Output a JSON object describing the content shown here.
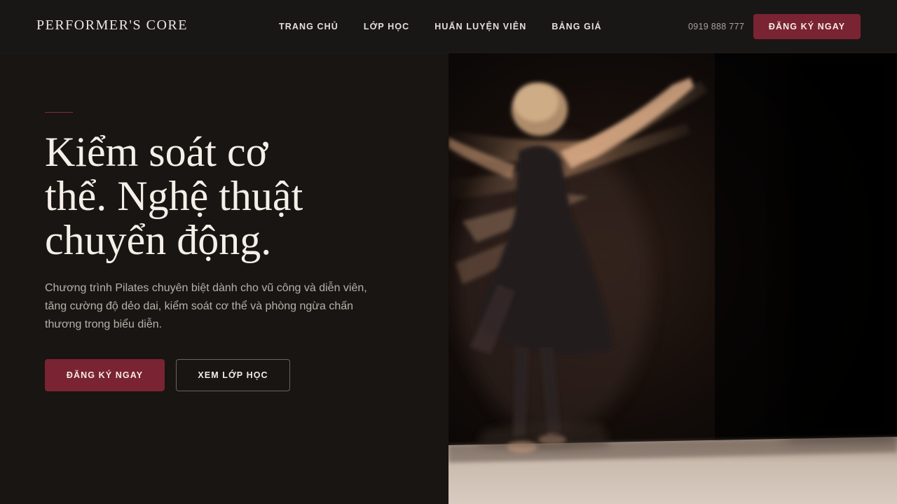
{
  "header": {
    "brand": "PERFORMER'S CORE",
    "nav": [
      "TRANG CHỦ",
      "LỚP HỌC",
      "HUẤN LUYỆN VIÊN",
      "BẢNG GIÁ"
    ],
    "phone": "0919 888 777",
    "cta_label": "ĐĂNG KÝ NGAY"
  },
  "hero": {
    "title_lines": [
      "Kiểm soát cơ",
      "thể. Nghệ thuật",
      "chuyển động."
    ],
    "description": "Chương trình Pilates chuyên biệt dành cho vũ công và diễn viên, tăng cường độ dẻo dai, kiểm soát cơ thể và phòng ngừa chấn thương trong biểu diễn.",
    "primary_button": "ĐĂNG KÝ NGAY",
    "secondary_button": "XEM LỚP HỌC",
    "image_subject": "dancer-motion-blur"
  },
  "colors": {
    "accent": "#7a2332",
    "background": "#181513",
    "text": "#f5efe8"
  }
}
